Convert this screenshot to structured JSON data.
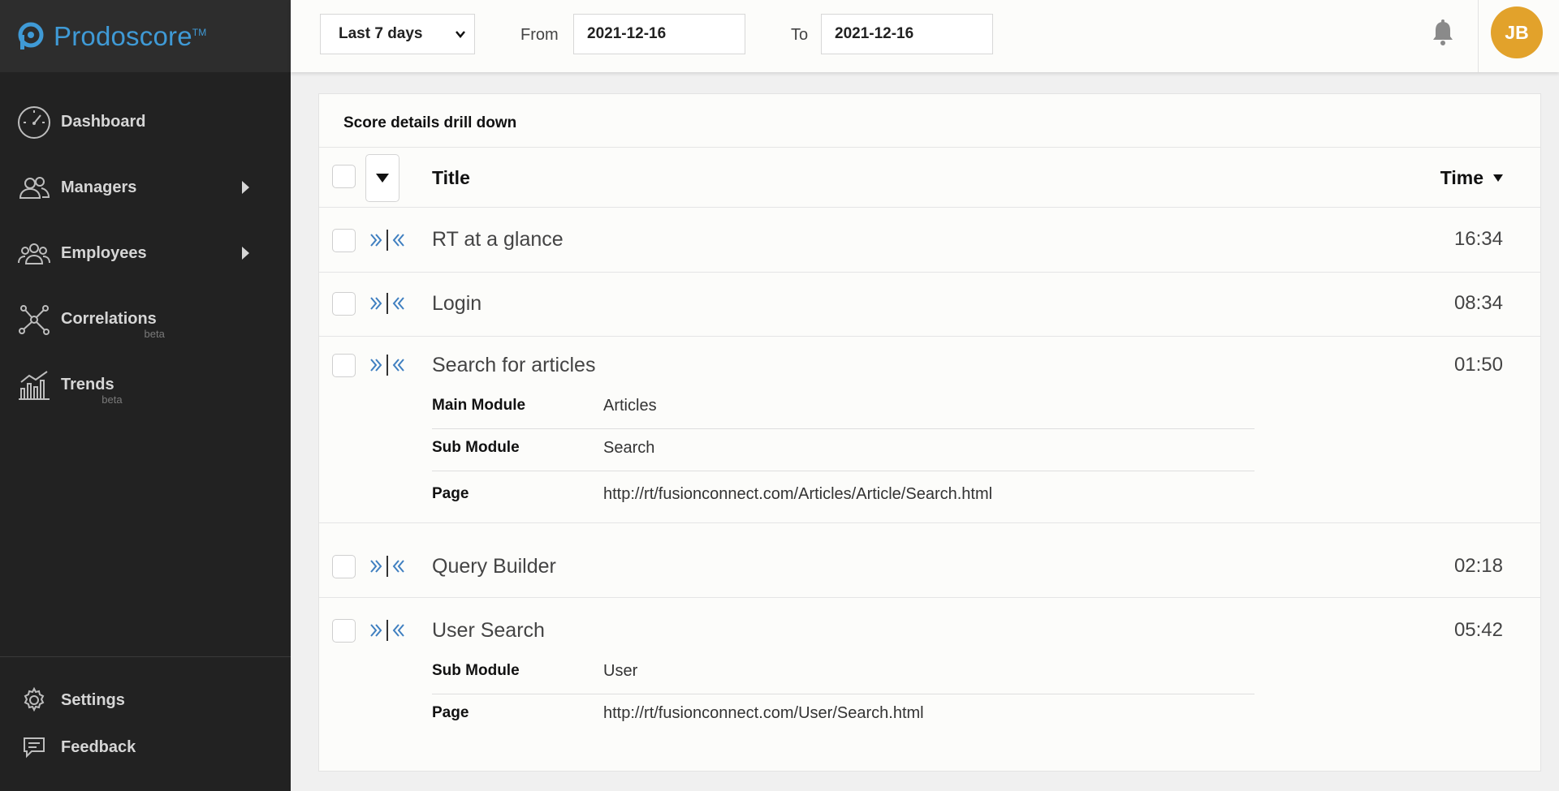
{
  "brand": {
    "name": "Prodoscore",
    "tm": "TM",
    "color": "#3f9ad6"
  },
  "nav": {
    "items": [
      {
        "label": "Dashboard"
      },
      {
        "label": "Managers"
      },
      {
        "label": "Employees"
      },
      {
        "label": "Correlations",
        "badge": "beta"
      },
      {
        "label": "Trends",
        "badge": "beta"
      }
    ],
    "bottom": [
      {
        "label": "Settings"
      },
      {
        "label": "Feedback"
      }
    ]
  },
  "topbar": {
    "range": "Last 7 days",
    "from_label": "From",
    "from_value": "2021-12-16",
    "to_label": "To",
    "to_value": "2021-12-16",
    "avatar": "JB",
    "avatar_color": "#e2a22b"
  },
  "card": {
    "title": "Score details drill down",
    "header": {
      "title": "Title",
      "time": "Time"
    },
    "rows": [
      {
        "title": "RT at a glance",
        "time": "16:34"
      },
      {
        "title": "Login",
        "time": "08:34"
      },
      {
        "title": "Search for articles",
        "time": "01:50",
        "details": [
          {
            "key": "Main Module",
            "value": "Articles"
          },
          {
            "key": "Sub Module",
            "value": "Search"
          },
          {
            "key": "Page",
            "value": "http://rt/fusionconnect.com/Articles/Article/Search.html"
          }
        ]
      },
      {
        "title": "Query Builder",
        "time": "02:18"
      },
      {
        "title": "User Search",
        "time": "05:42",
        "details": [
          {
            "key": "Sub Module",
            "value": "User"
          },
          {
            "key": "Page",
            "value": "http://rt/fusionconnect.com/User/Search.html"
          }
        ]
      }
    ]
  }
}
